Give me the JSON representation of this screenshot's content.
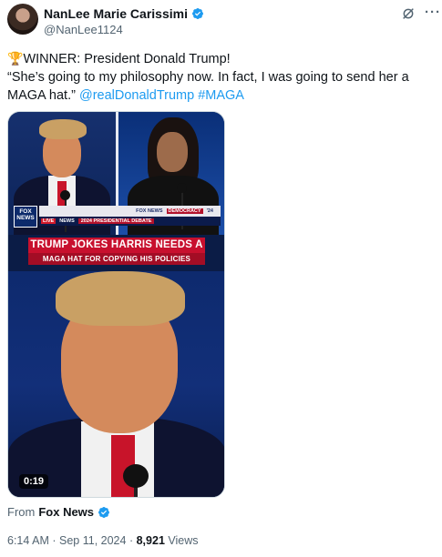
{
  "author": {
    "display_name": "NanLee Marie Carissimi",
    "handle": "@NanLee1124"
  },
  "header": {
    "more_label": "···"
  },
  "tweet": {
    "line1_emoji": "🏆",
    "line1_text": "WINNER: President Donald Trump!",
    "line2_text": "“She’s going to my philosophy now. In fact, I was going to send her a",
    "line3_text": "MAGA hat.”",
    "mention": "@realDonaldTrump",
    "hashtag": "#MAGA"
  },
  "media": {
    "fox_logo": "FOX NEWS",
    "topbar_network": "FOX NEWS",
    "topbar_party": "DEMOCRACY",
    "topbar_year": "'24",
    "live_label": "LIVE",
    "news_label": "NEWS",
    "debate_label": "2024 PRESIDENTIAL DEBATE",
    "headline_line1": "TRUMP JOKES HARRIS NEEDS A",
    "headline_line2": "MAGA HAT FOR COPYING HIS POLICIES",
    "duration": "0:19"
  },
  "source": {
    "prefix": "From",
    "name": "Fox News"
  },
  "meta": {
    "time": "6:14 AM",
    "separator": "·",
    "date": "Sep 11, 2024",
    "views_count": "8,921",
    "views_label": "Views"
  },
  "colors": {
    "verified_badge": "#1d9bf0",
    "link": "#1d9bf0",
    "headline_red": "#c8102e"
  }
}
